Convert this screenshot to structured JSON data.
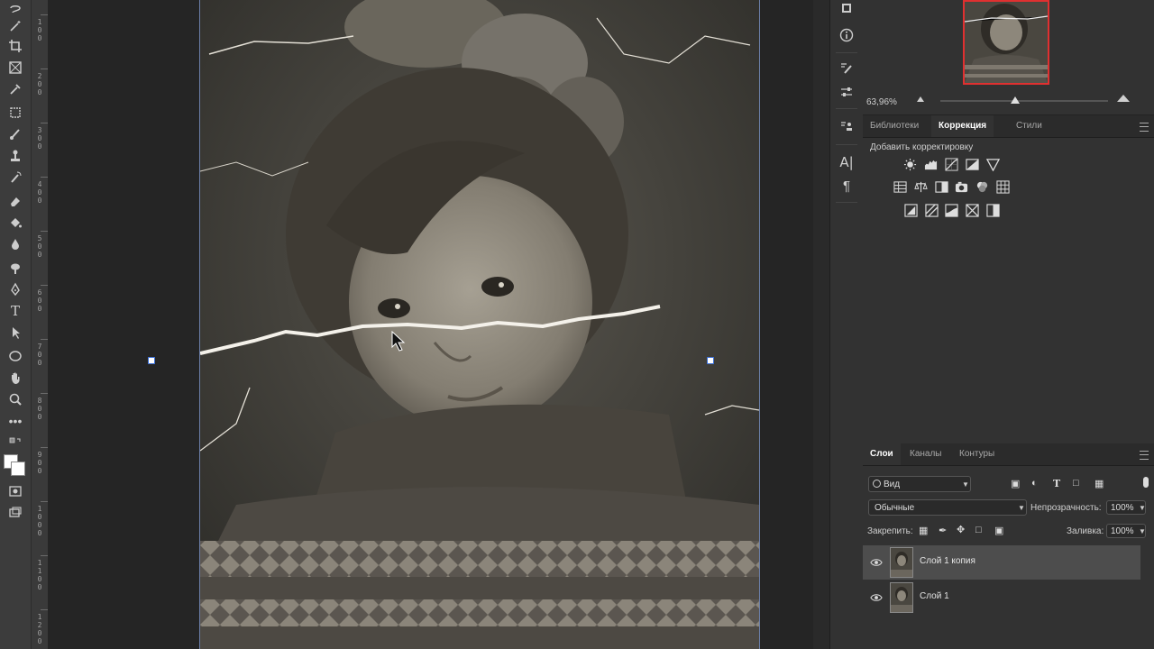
{
  "ruler": {
    "numbers": [
      "1\n0\n0",
      "2\n0\n0",
      "3\n0\n0",
      "4\n0\n0",
      "5\n0\n0",
      "6\n0\n0",
      "7\n0\n0",
      "8\n0\n0",
      "9\n0\n0",
      "1\n0\n0\n0",
      "1\n1\n0\n0",
      "1\n2\n0\n0"
    ]
  },
  "navigator": {
    "zoom": "63,96%"
  },
  "panel_tabs_top": {
    "tabs": [
      "Библиотеки",
      "Коррекция",
      "Стили"
    ],
    "active": "Коррекция"
  },
  "adjustments": {
    "title": "Добавить корректировку"
  },
  "layers_tabs": {
    "tabs": [
      "Слои",
      "Каналы",
      "Контуры"
    ],
    "active": "Слои"
  },
  "layers_controls": {
    "filter_label": "Вид",
    "blend_mode": "Обычные",
    "opacity_label": "Непрозрачность:",
    "opacity_value": "100%",
    "lock_label": "Закрепить:",
    "fill_label": "Заливка:",
    "fill_value": "100%"
  },
  "layers": [
    {
      "name": "Слой 1 копия",
      "selected": true,
      "visible": true
    },
    {
      "name": "Слой 1",
      "selected": false,
      "visible": true
    }
  ]
}
